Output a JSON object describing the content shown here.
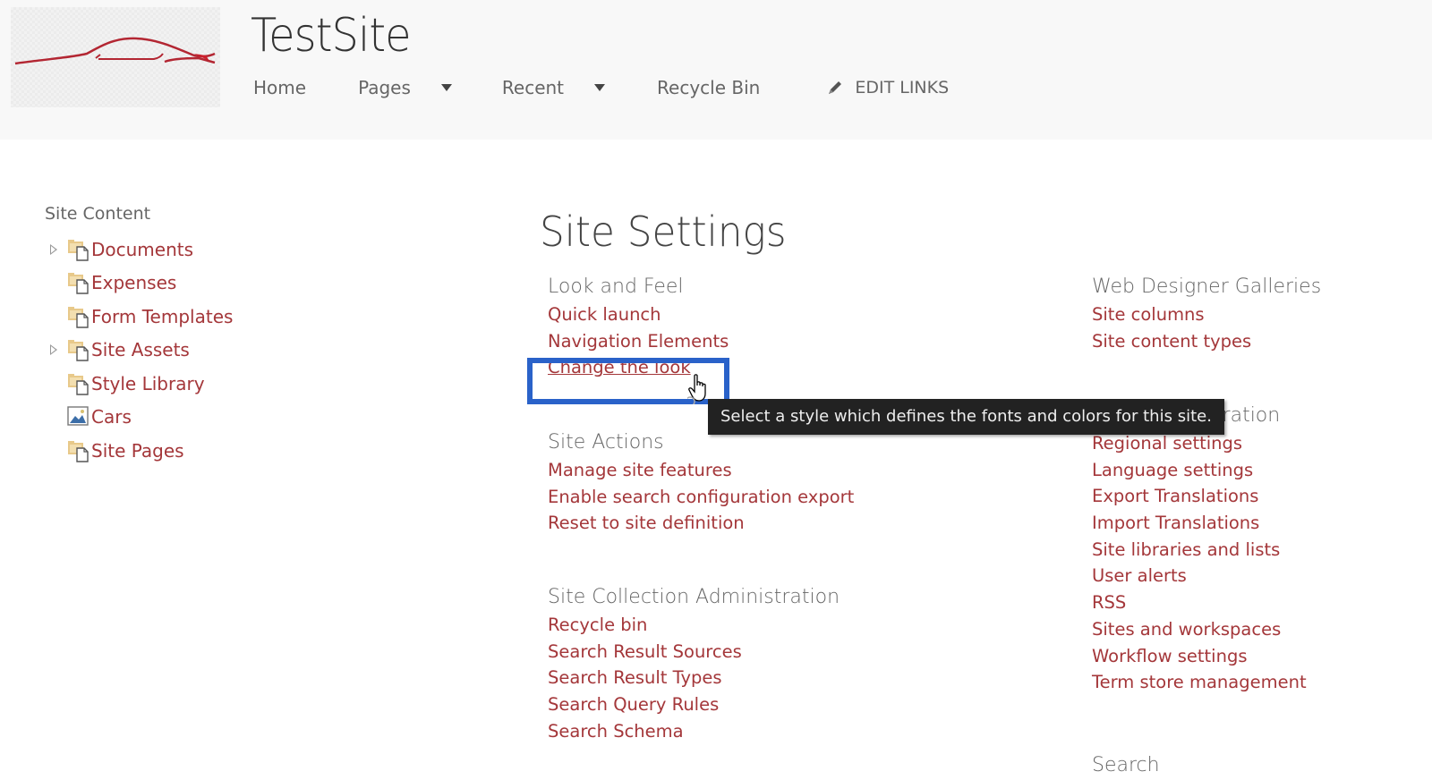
{
  "header": {
    "site_title": "TestSite",
    "logo_alt": "car-logo",
    "nav": [
      {
        "label": "Home",
        "has_dropdown": false
      },
      {
        "label": "Pages",
        "has_dropdown": true
      },
      {
        "label": "Recent",
        "has_dropdown": true
      },
      {
        "label": "Recycle Bin",
        "has_dropdown": false
      }
    ],
    "edit_links_label": "EDIT LINKS"
  },
  "sidebar": {
    "title": "Site Content",
    "items": [
      {
        "label": "Documents",
        "icon": "document-library-icon",
        "expandable": true
      },
      {
        "label": "Expenses",
        "icon": "document-library-icon",
        "expandable": false
      },
      {
        "label": "Form Templates",
        "icon": "document-library-icon",
        "expandable": false
      },
      {
        "label": "Site Assets",
        "icon": "document-library-icon",
        "expandable": true
      },
      {
        "label": "Style Library",
        "icon": "document-library-icon",
        "expandable": false
      },
      {
        "label": "Cars",
        "icon": "picture-library-icon",
        "expandable": false
      },
      {
        "label": "Site Pages",
        "icon": "document-library-icon",
        "expandable": false
      }
    ]
  },
  "main": {
    "title": "Site Settings",
    "sections": {
      "look_and_feel": {
        "heading": "Look and Feel",
        "links": [
          "Quick launch",
          "Navigation Elements",
          "Change the look"
        ]
      },
      "site_actions": {
        "heading": "Site Actions",
        "links": [
          "Manage site features",
          "Enable search configuration export",
          "Reset to site definition"
        ]
      },
      "site_collection_admin": {
        "heading": "Site Collection Administration",
        "links": [
          "Recycle bin",
          "Search Result Sources",
          "Search Result Types",
          "Search Query Rules",
          "Search Schema"
        ]
      },
      "web_designer_galleries": {
        "heading": "Web Designer Galleries",
        "links": [
          "Site columns",
          "Site content types"
        ]
      },
      "site_administration": {
        "heading": "Site Administration",
        "links": [
          "Regional settings",
          "Language settings",
          "Export Translations",
          "Import Translations",
          "Site libraries and lists",
          "User alerts",
          "RSS",
          "Sites and workspaces",
          "Workflow settings",
          "Term store management"
        ]
      },
      "search": {
        "heading": "Search"
      }
    }
  },
  "tooltip": {
    "text": "Select a style which defines the fonts and colors for this site."
  },
  "colors": {
    "link": "#a4373a",
    "highlight": "#2a62c9",
    "header_bg": "#f8f8f8",
    "tooltip_bg": "#222222"
  }
}
